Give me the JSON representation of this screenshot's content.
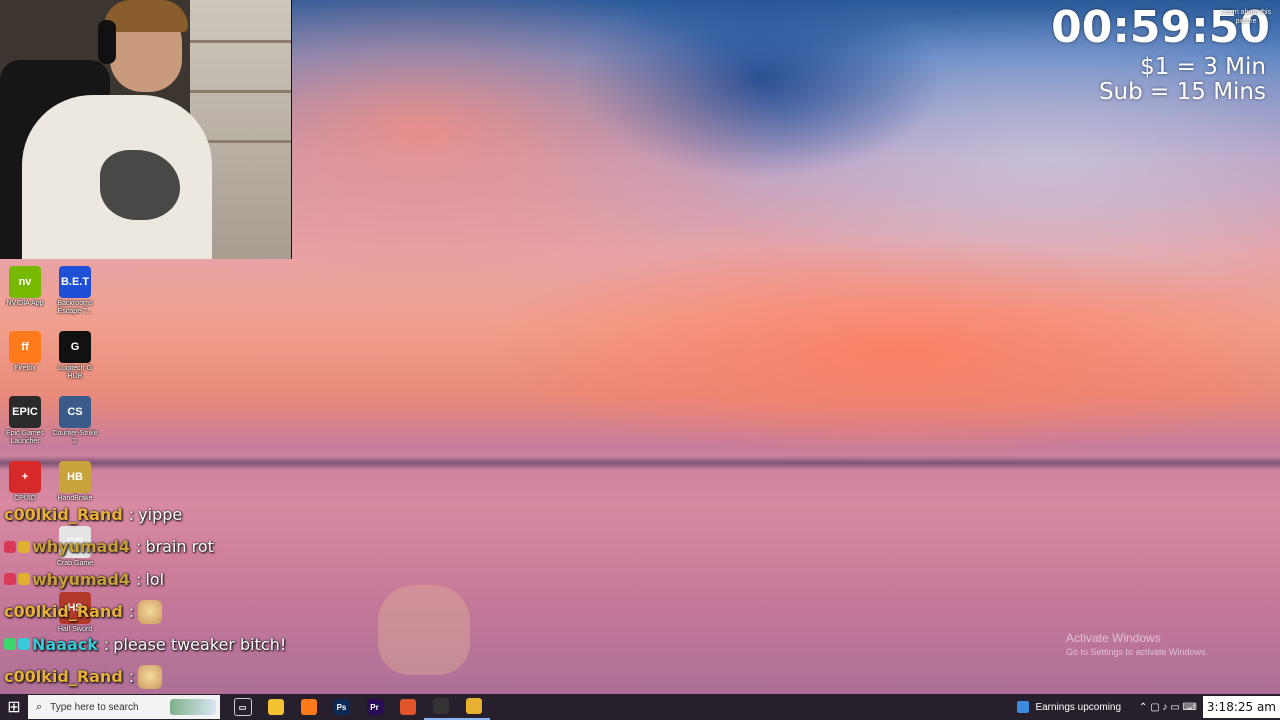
{
  "overlay": {
    "timer": "00:59:50",
    "rate_dollar": "$1 = 3 Min",
    "rate_sub": "Sub = 15 Mins",
    "learn_picture": "Learn about this picture"
  },
  "desktop_icons": [
    {
      "label": "NVIDIA App",
      "glyph": "nv",
      "color": "#76b900"
    },
    {
      "label": "Backrooms Escape T...",
      "glyph": "B.E.T",
      "color": "#1e4fd6"
    },
    {
      "label": "Firefox",
      "glyph": "ff",
      "color": "#ff7a1a"
    },
    {
      "label": "Logitech G HUB",
      "glyph": "G",
      "color": "#111111"
    },
    {
      "label": "Epic Games Launcher",
      "glyph": "EPIC",
      "color": "#2a2a2a"
    },
    {
      "label": "Counter-Strike 2",
      "glyph": "CS",
      "color": "#3a5a8a"
    },
    {
      "label": "CPUID",
      "glyph": "+",
      "color": "#d62a2a"
    },
    {
      "label": "HandBrake",
      "glyph": "HB",
      "color": "#c8a23a"
    },
    {
      "label": "Crab Game",
      "glyph": "CG",
      "color": "#e4e4e4"
    },
    {
      "label": "Half Sword",
      "glyph": "HS",
      "color": "#b33a2a"
    }
  ],
  "chat": [
    {
      "user": "c00lkid_Rand",
      "color": "#e8b23a",
      "message": "yippe",
      "emote": false,
      "badges": []
    },
    {
      "user": "whyumad4",
      "color": "#c9a13a",
      "message": "brain rot",
      "emote": false,
      "badges": [
        "#d93a5a",
        "#e0b030"
      ]
    },
    {
      "user": "whyumad4",
      "color": "#c9a13a",
      "message": "lol",
      "emote": false,
      "badges": [
        "#d93a5a",
        "#e0b030"
      ]
    },
    {
      "user": "c00lkid_Rand",
      "color": "#e8b23a",
      "message": "",
      "emote": true,
      "badges": []
    },
    {
      "user": "Naaack",
      "color": "#3ac9d8",
      "message": "please tweaker bitch!",
      "emote": false,
      "badges": [
        "#3ad86a",
        "#3ac9d8"
      ]
    },
    {
      "user": "c00lkid_Rand",
      "color": "#e8b23a",
      "message": "",
      "emote": true,
      "badges": []
    }
  ],
  "watermark": {
    "line1": "Activate Windows",
    "line2": "Go to Settings to activate Windows."
  },
  "taskbar": {
    "search_placeholder": "Type here to search",
    "apps": [
      {
        "name": "task-view",
        "glyph": "▭",
        "color": "#00000000",
        "active": false
      },
      {
        "name": "file-explorer",
        "glyph": "",
        "color": "#f2c230",
        "active": false
      },
      {
        "name": "firefox",
        "glyph": "",
        "color": "#ff7a1a",
        "active": false
      },
      {
        "name": "photoshop",
        "glyph": "Ps",
        "color": "#0a2a55",
        "active": false
      },
      {
        "name": "premiere",
        "glyph": "Pr",
        "color": "#2a0a55",
        "active": false
      },
      {
        "name": "firefox-alt",
        "glyph": "",
        "color": "#e0552a",
        "active": false
      },
      {
        "name": "obs",
        "glyph": "",
        "color": "#333333",
        "active": true
      },
      {
        "name": "kitty-app",
        "glyph": "",
        "color": "#e8b030",
        "active": true
      }
    ],
    "news": "Earnings upcoming",
    "tray_icons": "⌃ ▢ ♪ ▭ ⌨",
    "clock": "3:18:25 am"
  }
}
